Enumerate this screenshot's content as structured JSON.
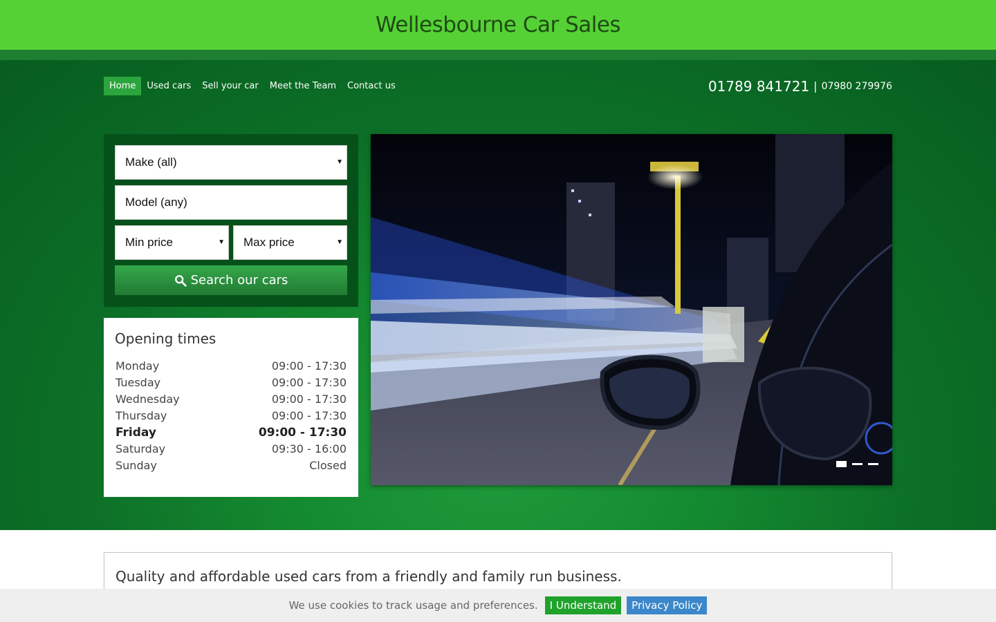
{
  "site": {
    "title": "Wellesbourne Car Sales"
  },
  "nav": {
    "items": [
      {
        "label": "Home",
        "active": true
      },
      {
        "label": "Used cars"
      },
      {
        "label": "Sell your car"
      },
      {
        "label": "Meet the Team"
      },
      {
        "label": "Contact us"
      }
    ]
  },
  "contact": {
    "phone_main": "01789 841721",
    "separator": "|",
    "phone_alt": "07980 279976"
  },
  "search": {
    "make": "Make (all)",
    "model_placeholder": "Model (any)",
    "min_price": "Min price",
    "max_price": "Max price",
    "button_label": "Search our cars",
    "icon": "search-icon"
  },
  "hours": {
    "title": "Opening times",
    "rows": [
      {
        "day": "Monday",
        "time": "09:00 - 17:30"
      },
      {
        "day": "Tuesday",
        "time": "09:00 - 17:30"
      },
      {
        "day": "Wednesday",
        "time": "09:00 - 17:30"
      },
      {
        "day": "Thursday",
        "time": "09:00 - 17:30"
      },
      {
        "day": "Friday",
        "time": "09:00 - 17:30",
        "today": true
      },
      {
        "day": "Saturday",
        "time": "09:30 - 16:00"
      },
      {
        "day": "Sunday",
        "time": "Closed"
      }
    ]
  },
  "slider": {
    "slide_count": 3,
    "active_index": 0
  },
  "intro": {
    "heading": "Quality and affordable used cars from a friendly and family run business."
  },
  "cookie": {
    "text": "We use cookies to track usage and preferences.",
    "accept_label": "I Understand",
    "privacy_label": "Privacy Policy"
  },
  "colors": {
    "top_bar": "#55d136",
    "hero_green": "#0c6f27",
    "accept_button": "#1fa32a",
    "privacy_button": "#3b87c9"
  }
}
